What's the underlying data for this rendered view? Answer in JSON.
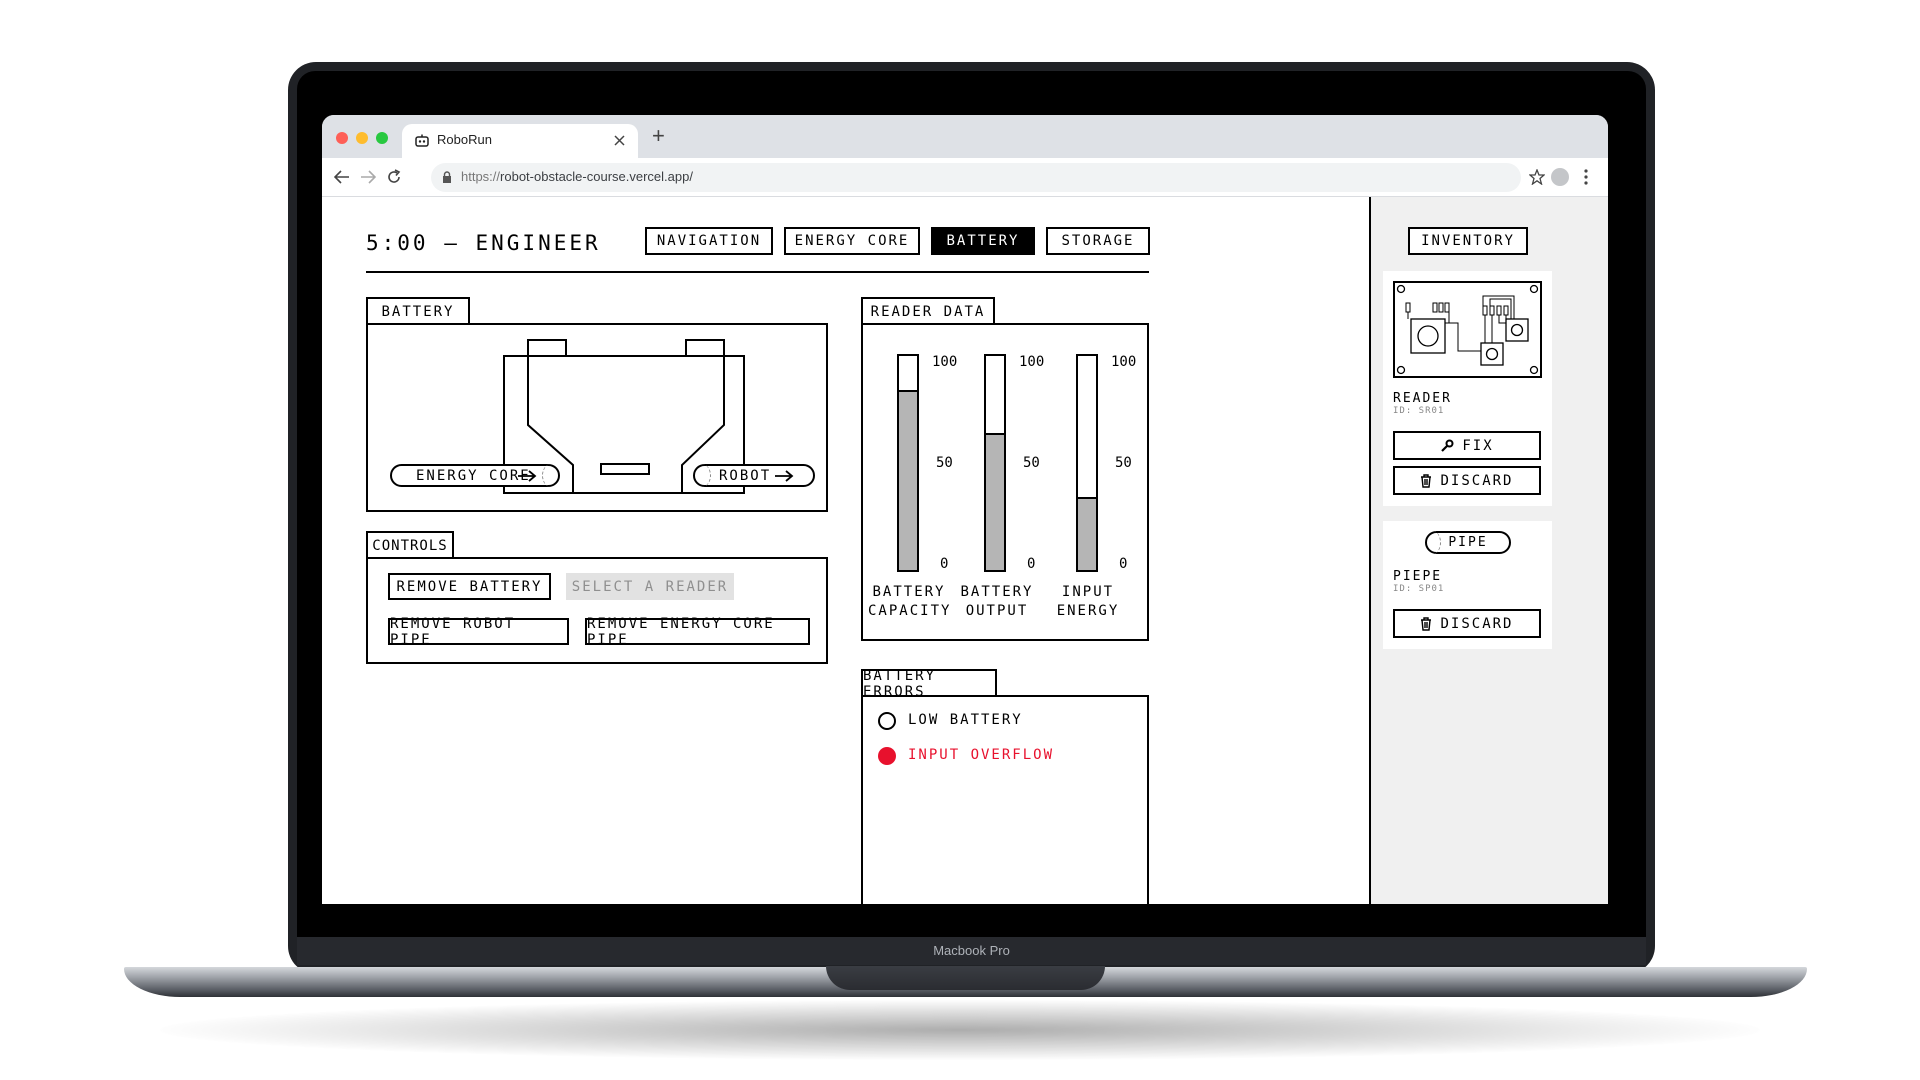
{
  "device": {
    "label": "Macbook Pro"
  },
  "browser": {
    "tab_title": "RoboRun",
    "url_scheme": "https://",
    "url_host": "robot-obstacle-course.vercel.app/",
    "new_tab": "+"
  },
  "header": {
    "title": "5:00 — ENGINEER",
    "nav": [
      {
        "label": "NAVIGATION",
        "active": false
      },
      {
        "label": "ENERGY CORE",
        "active": false
      },
      {
        "label": "BATTERY",
        "active": true
      },
      {
        "label": "STORAGE",
        "active": false
      }
    ]
  },
  "battery_panel": {
    "title": "BATTERY",
    "energy_core_pipe": "ENERGY CORE",
    "robot_pipe": "ROBOT"
  },
  "controls": {
    "title": "CONTROLS",
    "remove_battery": "REMOVE BATTERY",
    "select_reader": "SELECT A READER",
    "remove_robot_pipe": "REMOVE ROBOT PIPE",
    "remove_energy_core_pipe": "REMOVE ENERGY CORE PIPE"
  },
  "reader_data": {
    "title": "READER DATA",
    "ticks": [
      "100",
      "50",
      "0"
    ],
    "bars": [
      {
        "label_line1": "BATTERY",
        "label_line2": "CAPACITY",
        "level": 0.83
      },
      {
        "label_line1": "BATTERY",
        "label_line2": "OUTPUT",
        "level": 0.63
      },
      {
        "label_line1": "INPUT",
        "label_line2": "ENERGY",
        "level": 0.33
      }
    ]
  },
  "battery_errors": {
    "title": "BATTERY ERRORS",
    "items": [
      {
        "label": "LOW BATTERY",
        "active": false
      },
      {
        "label": "INPUT OVERFLOW",
        "active": true
      }
    ]
  },
  "inventory": {
    "title": "INVENTORY",
    "items": [
      {
        "name": "READER",
        "id": "ID: SR01",
        "fix": "FIX",
        "discard": "DISCARD"
      },
      {
        "badge": "PIPE",
        "name": "PIEPE",
        "id": "ID: SP01",
        "discard": "DISCARD"
      }
    ]
  },
  "colors": {
    "error": "#e8112d",
    "fill": "#b5b5b5",
    "ink": "#000000"
  }
}
